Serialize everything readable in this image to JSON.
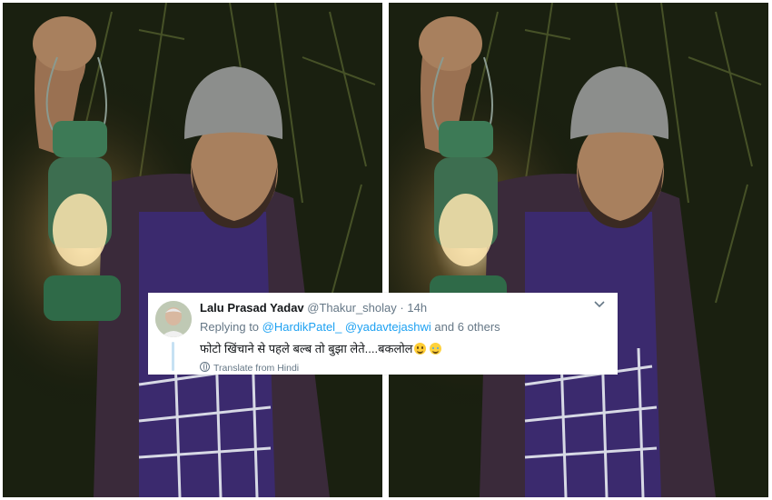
{
  "tweet": {
    "name": "Lalu Prasad Yadav",
    "handle": "@Thakur_sholay",
    "separator": "·",
    "time": "14h",
    "menu_icon": "chevron-down-icon",
    "reply_prefix": "Replying to",
    "reply_mention_1": "@HardikPatel_",
    "reply_mention_2": "@yadavtejashwi",
    "reply_suffix": "and 6 others",
    "text": "फोटो खिंचाने से पहले बल्ब तो बुझा लेते....बकलोल",
    "emoji_1": "smiley-emoji",
    "emoji_2": "tears-of-joy-emoji",
    "translate_label": "Translate from Hindi",
    "translate_icon": "globe-icon"
  },
  "colors": {
    "link": "#1da1f2",
    "muted": "#657786",
    "text": "#14171a"
  }
}
